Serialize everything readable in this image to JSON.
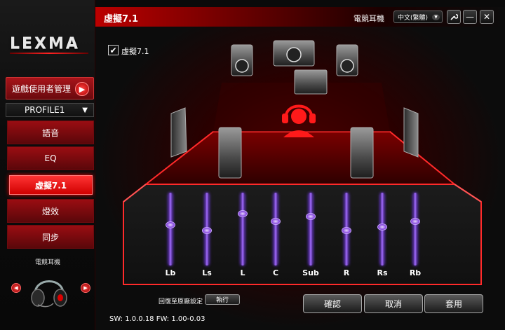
{
  "brand": {
    "logo": "LEXMA"
  },
  "header": {
    "title": "虛擬7.1",
    "device_name": "電競耳機",
    "language": "中文(繁體)",
    "window_controls": {
      "tool": "⚙",
      "minimize": "—",
      "close": "✕"
    }
  },
  "sidebar": {
    "manager_button": "遊戲使用者管理",
    "profile": "PROFILE1",
    "nav": [
      {
        "label": "語音"
      },
      {
        "label": "EQ"
      },
      {
        "label": "虛擬7.1"
      },
      {
        "label": "燈效"
      },
      {
        "label": "同步"
      }
    ],
    "active_index": 2,
    "device_label": "電競耳機"
  },
  "virtual71": {
    "enabled": true,
    "checkbox_label": "虛擬7.1",
    "sliders": [
      {
        "label": "Lb",
        "level": 0.44
      },
      {
        "label": "Ls",
        "level": 0.52
      },
      {
        "label": "L",
        "level": 0.27
      },
      {
        "label": "C",
        "level": 0.38
      },
      {
        "label": "Sub",
        "level": 0.31
      },
      {
        "label": "R",
        "level": 0.52
      },
      {
        "label": "Rs",
        "level": 0.47
      },
      {
        "label": "Rb",
        "level": 0.38
      }
    ]
  },
  "footer": {
    "reset_label": "回復至原廠設定",
    "execute_label": "執行",
    "ok": "確認",
    "cancel": "取消",
    "apply": "套用",
    "version": "SW: 1.0.0.18   FW: 1.00-0.03"
  },
  "colors": {
    "accent": "#e00000",
    "slider": "#9a66ff"
  }
}
